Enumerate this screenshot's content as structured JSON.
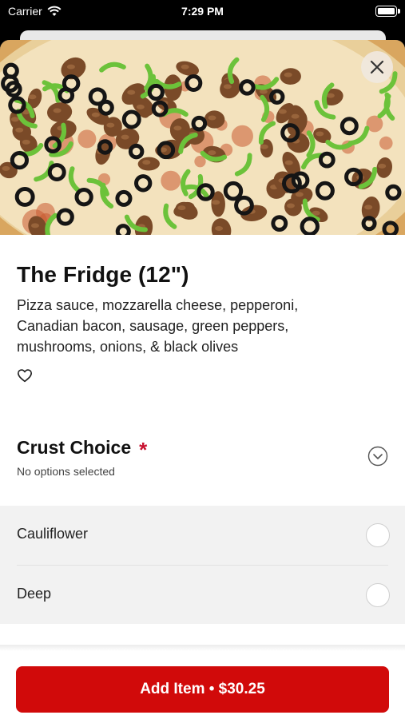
{
  "status_bar": {
    "carrier": "Carrier",
    "time": "7:29 PM"
  },
  "item": {
    "title": "The Fridge (12\")",
    "description": "Pizza sauce, mozzarella cheese, pepperoni, Canadian bacon, sausage, green peppers, mushrooms, onions, & black olives"
  },
  "crust": {
    "title": "Crust Choice",
    "required_mark": "*",
    "subtitle": "No options selected",
    "options": [
      {
        "label": "Cauliflower",
        "selected": false
      },
      {
        "label": "Deep",
        "selected": false
      }
    ]
  },
  "footer": {
    "add_label": "Add Item • $30.25"
  },
  "colors": {
    "accent": "#d10a0a",
    "required": "#c8102e"
  },
  "icons": [
    "wifi-icon",
    "battery-icon",
    "close-icon",
    "heart-icon",
    "chevron-down-icon",
    "radio-icon"
  ]
}
